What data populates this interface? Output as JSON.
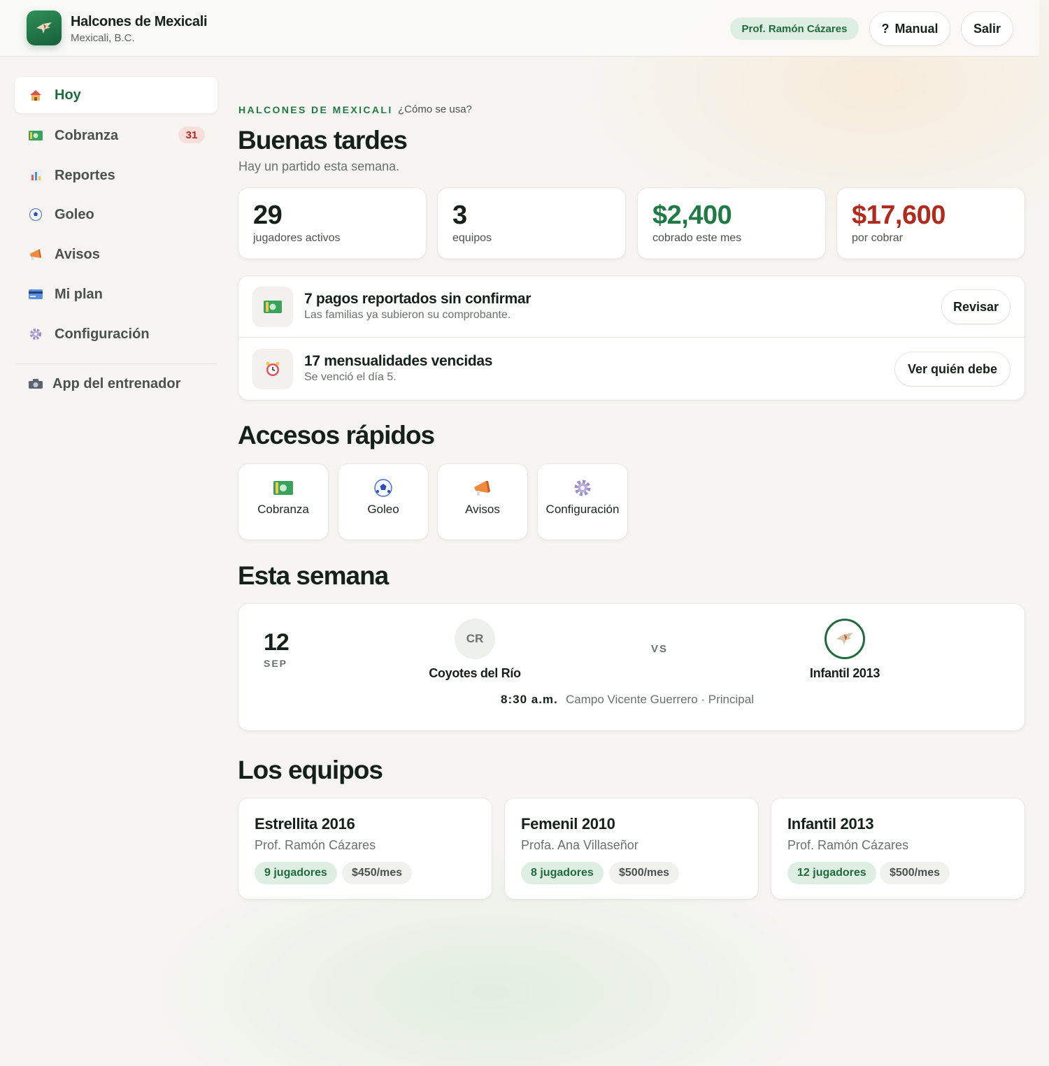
{
  "header": {
    "club_name": "Halcones de Mexicali",
    "club_location": "Mexicali, B.C.",
    "user": "Prof. Ramón Cázares",
    "manual_label": "Manual",
    "manual_icon_text": "?",
    "logout_label": "Salir",
    "logo_icon": "hawk-icon"
  },
  "sidebar": {
    "items": [
      {
        "label": "Hoy",
        "icon": "house-icon",
        "active": true
      },
      {
        "label": "Cobranza",
        "icon": "money-icon",
        "badge": "31"
      },
      {
        "label": "Reportes",
        "icon": "bar-chart-icon"
      },
      {
        "label": "Goleo",
        "icon": "soccer-ball-icon"
      },
      {
        "label": "Avisos",
        "icon": "megaphone-icon"
      },
      {
        "label": "Mi plan",
        "icon": "credit-card-icon"
      },
      {
        "label": "Configuración",
        "icon": "gear-icon"
      }
    ],
    "coach_app": {
      "label": "App del entrenador",
      "icon": "camera-icon"
    }
  },
  "main": {
    "eyebrow": "HALCONES DE MEXICALI",
    "howto": "¿Cómo se usa?",
    "greeting": "Buenas tardes",
    "subtitle": "Hay un partido esta semana.",
    "stats": [
      {
        "value": "29",
        "label": "jugadores activos"
      },
      {
        "value": "3",
        "label": "equipos"
      },
      {
        "value": "$2,400",
        "label": "cobrado este mes",
        "color": "#1f7a45"
      },
      {
        "value": "$17,600",
        "label": "por cobrar",
        "color": "#b02a1e"
      }
    ],
    "alerts": [
      {
        "title": "7 pagos reportados sin confirmar",
        "subtitle": "Las familias ya subieron su comprobante.",
        "action": "Revisar",
        "icon": "money-icon"
      },
      {
        "title": "17 mensualidades vencidas",
        "subtitle": "Se venció el día 5.",
        "action": "Ver quién debe",
        "icon": "alarm-clock-icon"
      }
    ],
    "quick_title": "Accesos rápidos",
    "quick": [
      {
        "label": "Cobranza",
        "icon": "money-icon"
      },
      {
        "label": "Goleo",
        "icon": "soccer-ball-icon"
      },
      {
        "label": "Avisos",
        "icon": "megaphone-icon"
      },
      {
        "label": "Configuración",
        "icon": "gear-icon"
      }
    ],
    "week_title": "Esta semana",
    "match": {
      "day": "12",
      "month": "SEP",
      "away_initials": "CR",
      "away_name": "Coyotes del Río",
      "vs": "VS",
      "home_name": "Infantil 2013",
      "time": "8:30 a.m.",
      "place": "Campo Vicente Guerrero · Principal"
    },
    "teams_title": "Los equipos",
    "teams": [
      {
        "name": "Estrellita 2016",
        "coach": "Prof. Ramón Cázares",
        "players": "9 jugadores",
        "fee": "$450/mes"
      },
      {
        "name": "Femenil 2010",
        "coach": "Profa. Ana Villaseñor",
        "players": "8 jugadores",
        "fee": "$500/mes"
      },
      {
        "name": "Infantil 2013",
        "coach": "Prof. Ramón Cázares",
        "players": "12 jugadores",
        "fee": "$500/mes"
      }
    ]
  },
  "colors": {
    "brand": "#1f7a45",
    "danger": "#b02a1e"
  }
}
